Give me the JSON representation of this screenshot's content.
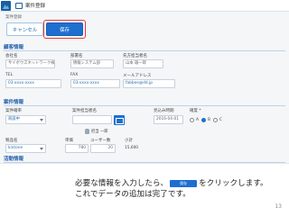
{
  "header": {
    "title": "案件登録"
  },
  "toolbar": {
    "sub_label": "案件登録",
    "cancel_label": "キャンセル",
    "save_label": "保存"
  },
  "sections": {
    "customer": "顧客情報",
    "project": "案件情報",
    "activity": "活動情報"
  },
  "customer": {
    "company_label": "会社名",
    "company_value": "サイボウズネットワーク株式会社",
    "dept_label": "部署名",
    "dept_value": "情報システム部",
    "contact_label": "先方担当者名",
    "contact_value": "山本 雄一郎",
    "tel_label": "TEL",
    "tel_value": "03-xxxx-xxxx",
    "fax_label": "FAX",
    "fax_value": "03-xxxx-xxxx",
    "mail_label": "メールアドレス",
    "mail_value": "fabbee@dd.jp"
  },
  "project": {
    "name_label": "案件確率",
    "name_value": "商談中",
    "owner_label": "案件担当者名",
    "owner_placeholder": "",
    "owner_chip": "担当 一郎",
    "date_label": "見込み時期",
    "date_value": "2016-04-01",
    "prob_label": "確度 *",
    "prob_options": [
      "A",
      "B",
      "C"
    ],
    "product_label": "製品名",
    "product_value": "kintone",
    "price_label": "単価",
    "price_value": "780",
    "users_label": "ユーザー数",
    "users_value": "20",
    "subtotal_label": "小計",
    "subtotal_value": "15,600"
  },
  "caption": {
    "line1_before": "必要な情報を入力したら、",
    "inline_button": "保存",
    "line1_after": "をクリックします。",
    "line2": "これでデータの追加は完了です。"
  },
  "page_number": "13"
}
